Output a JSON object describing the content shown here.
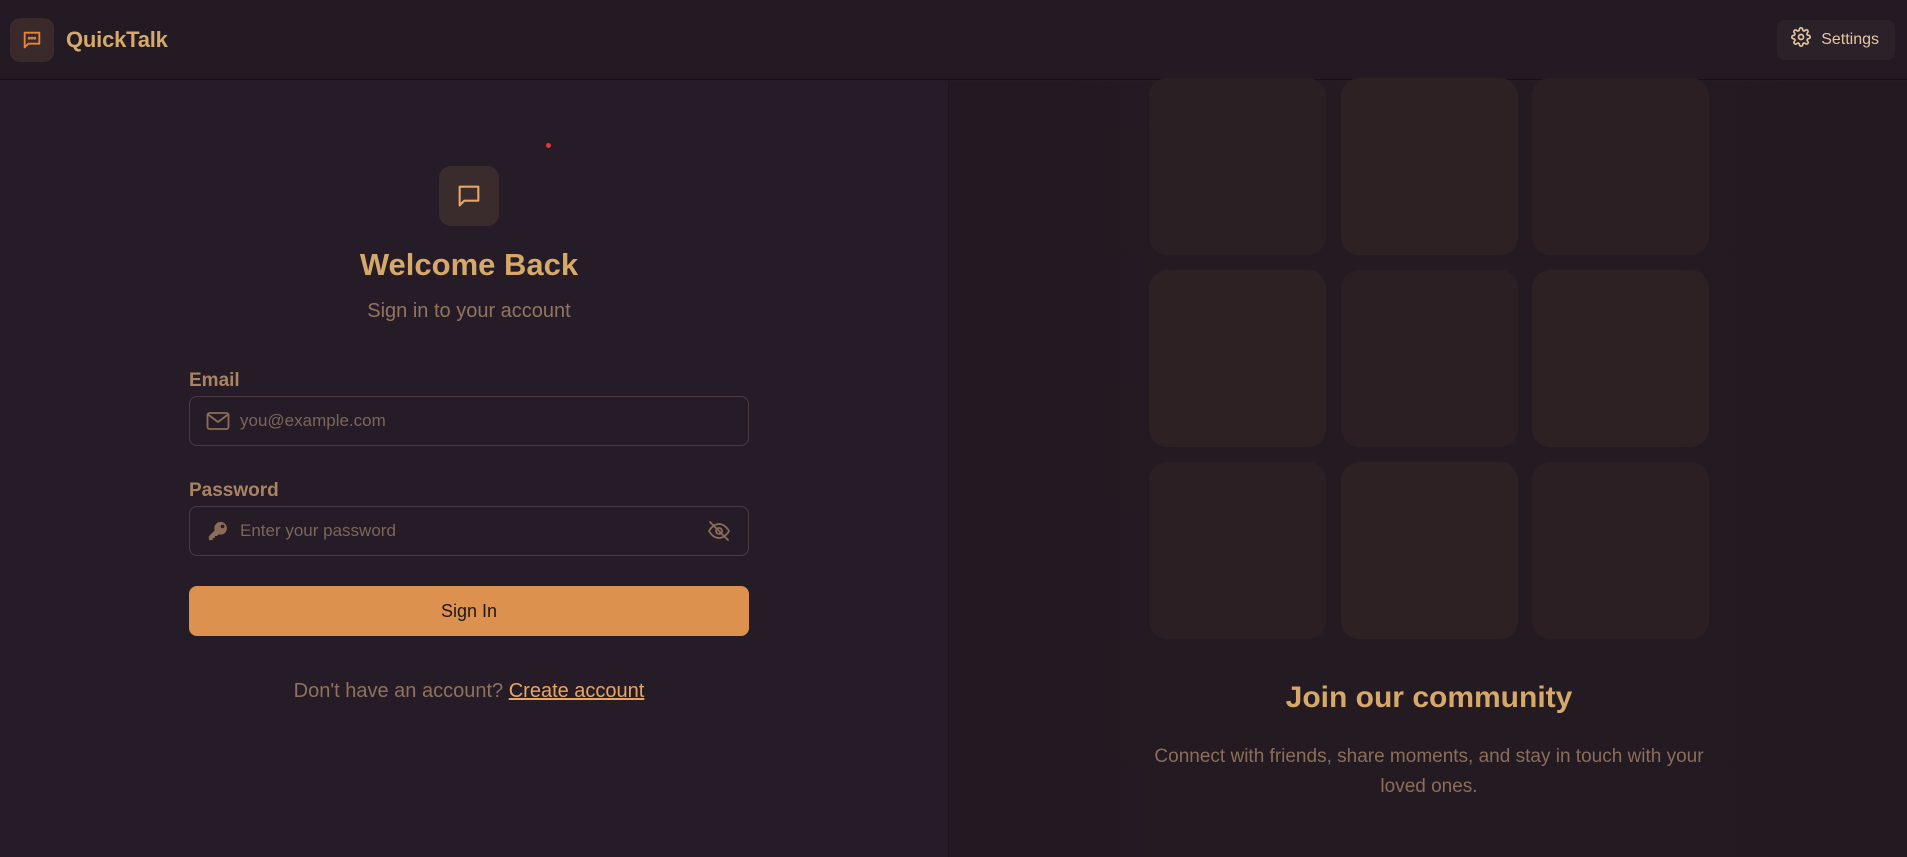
{
  "app": {
    "name": "QuickTalk",
    "logo_icon": "chat-bubble-dots-icon"
  },
  "header": {
    "settings_label": "Settings",
    "settings_icon": "gear-icon"
  },
  "login": {
    "title": "Welcome Back",
    "subtitle": "Sign in to your account",
    "email": {
      "label": "Email",
      "placeholder": "you@example.com",
      "value": "",
      "icon": "mail-icon"
    },
    "password": {
      "label": "Password",
      "placeholder": "Enter your password",
      "value": "",
      "icon": "key-icon",
      "toggle_icon": "eye-off-icon"
    },
    "submit_label": "Sign In",
    "signup_prompt": "Don't have an account?",
    "signup_link": "Create account"
  },
  "community": {
    "title": "Join our community",
    "description": "Connect with friends, share moments, and stay in touch with your loved ones."
  },
  "colors": {
    "accent": "#dc924e",
    "brand_text": "#d6a86a",
    "background": "#261c27"
  }
}
